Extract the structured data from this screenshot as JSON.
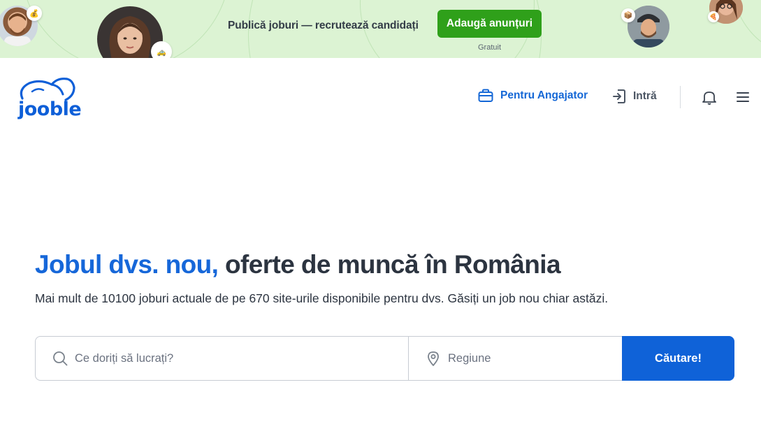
{
  "promo": {
    "text": "Publică joburi — recrutează candidați",
    "button_label": "Adaugă anunțuri",
    "subtext": "Gratuit"
  },
  "header": {
    "logo_text": "jooble",
    "employer_label": "Pentru Angajator",
    "login_label": "Intră",
    "icons": [
      "briefcase-icon",
      "login-icon",
      "bell-icon",
      "menu-icon"
    ]
  },
  "hero": {
    "title_accent": "Jobul dvs. nou,",
    "title_rest": "oferte de muncă în România",
    "subtitle": "Mai mult de 10100 joburi actuale de pe 670 site-urile disponibile pentru dvs. Găsiți un job nou chiar astăzi."
  },
  "search": {
    "job_placeholder": "Ce doriți să lucrați?",
    "region_placeholder": "Regiune",
    "button_label": "Căutare!"
  },
  "colors": {
    "promo_bg": "#dcf3d3",
    "promo_button": "#2fa01a",
    "brand_blue": "#1667d9",
    "search_button": "#0f62d8"
  }
}
